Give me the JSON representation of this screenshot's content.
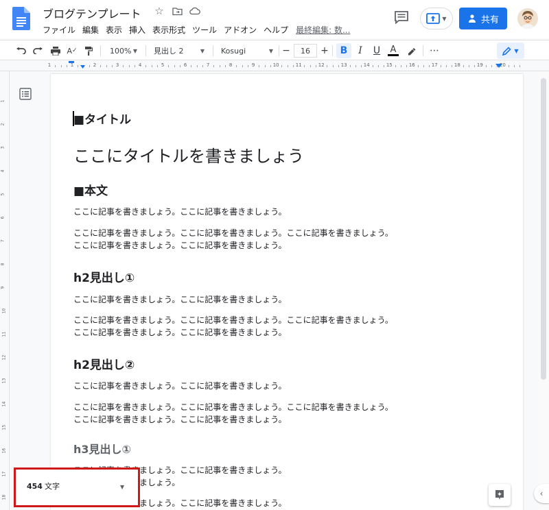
{
  "app": {
    "doc_title": "ブログテンプレート",
    "menu": [
      "ファイル",
      "編集",
      "表示",
      "挿入",
      "表示形式",
      "ツール",
      "アドオン",
      "ヘルプ"
    ],
    "last_edit": "最終編集: 数...",
    "share_label": "共有",
    "colors": {
      "accent": "#1a73e8",
      "doc_blue": "#4285f4",
      "highlight_border": "#d01818"
    }
  },
  "toolbar": {
    "zoom": "100%",
    "style": "見出し 2",
    "font": "Kosugi",
    "font_size": "16",
    "minus": "−",
    "plus": "+",
    "bold": "B",
    "italic": "I",
    "underline": "U",
    "text_color": "A",
    "more": "⋯"
  },
  "ruler": {
    "numbers": [
      "1",
      "1",
      "2",
      "3",
      "4",
      "5",
      "6",
      "7",
      "8",
      "9",
      "10",
      "11",
      "12",
      "13",
      "14",
      "15",
      "16",
      "17",
      "18",
      "19",
      "20"
    ]
  },
  "vruler": {
    "numbers": [
      "1",
      "2",
      "3",
      "4",
      "5",
      "6",
      "7",
      "8",
      "9",
      "10",
      "11",
      "12",
      "13",
      "14",
      "15",
      "16",
      "17",
      "18"
    ]
  },
  "document": {
    "title_label": "■タイトル",
    "big_title": "ここにタイトルを書きましょう",
    "body_label": "■本文",
    "p_single": "ここに記事を書きましょう。ここに記事を書きましょう。",
    "p_double_1": "ここに記事を書きましょう。ここに記事を書きましょう。ここに記事を書きましょう。",
    "p_double_2": "ここに記事を書きましょう。ここに記事を書きましょう。",
    "h2_1": "h2見出し①",
    "h2_2": "h2見出し②",
    "h3_1": "h3見出し①",
    "p_partial_1": "ここに記事を書きましょう。ここに記事を書きましょう。",
    "p_partial_2": "ここに記事を書きましょう。"
  },
  "word_count": {
    "number": "454",
    "unit": "文字"
  }
}
